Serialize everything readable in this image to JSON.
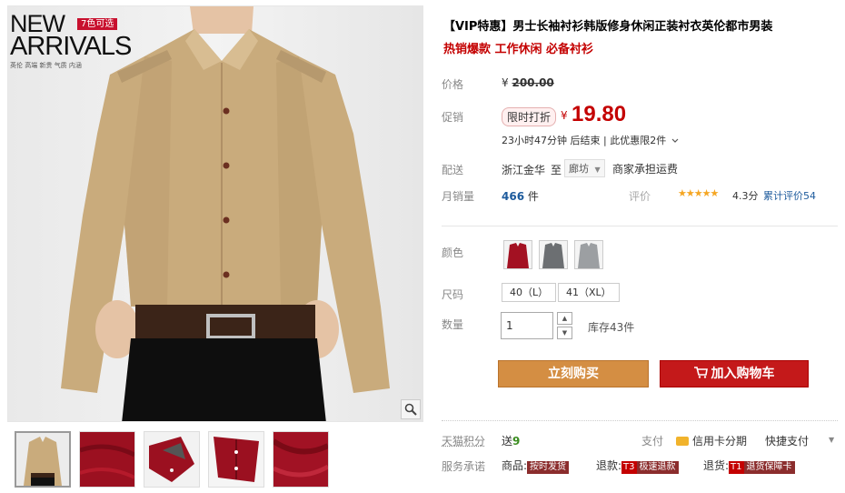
{
  "gallery": {
    "logo_line1": "NEW",
    "logo_line2": "ARRIVALS",
    "logo_badge": "7色可选",
    "logo_tags": "英伦  高端  新贵   气质   内涵",
    "zoom_icon": "magnifier-icon",
    "thumbnails": [
      "thumb-khaki-shirt",
      "thumb-red-shirt",
      "thumb-red-collar",
      "thumb-red-sleeve",
      "thumb-red-fabric"
    ]
  },
  "product": {
    "title": "【VIP特惠】男士长袖衬衫韩版修身休闲正装衬衣英伦都市男装",
    "subtitle": "热销爆款 工作休闲 必备衬衫"
  },
  "pricing": {
    "price_label": "价格",
    "currency": "¥",
    "original_price": "200.00",
    "promo_label": "促销",
    "promo_badge": "限时打折",
    "current_price": "19.80",
    "timer_text": "23小时47分钟 后结束 | 此优惠限2件",
    "timer_chevron": "chevron-down-icon"
  },
  "shipping": {
    "label": "配送",
    "from": "浙江金华",
    "to_word": "至",
    "destination": "廊坊",
    "fee_text": "商家承担运费"
  },
  "sales": {
    "label": "月销量",
    "count": "466",
    "unit": "件",
    "rating_label": "评价",
    "stars": "★★★★★",
    "score": "4.3分",
    "review_text": "累计评价",
    "review_count": "54"
  },
  "options": {
    "color_label": "颜色",
    "colors": [
      "red",
      "gray",
      "light-gray"
    ],
    "size_label": "尺码",
    "sizes": [
      "40（L）",
      "41（XL）"
    ],
    "qty_label": "数量",
    "qty_value": "1",
    "stock_text": "库存43件"
  },
  "actions": {
    "buy_now": "立刻购买",
    "add_to_cart": "加入购物车",
    "cart_icon": "cart-icon"
  },
  "services": {
    "points_label": "天猫积分",
    "points_prefix": "送",
    "points_value": "9",
    "pay_label": "支付",
    "credit_text": "信用卡分期",
    "quick_pay": "快捷支付",
    "promise_label": "服务承诺",
    "goods_label": "商品:",
    "goods_tag": "按时发货",
    "refund_label": "退款:",
    "refund_num": "T3",
    "refund_tag": "极速退款",
    "return_label": "退货:",
    "return_num": "T1",
    "return_tag": "退货保障卡"
  },
  "colors": {
    "price_red": "#c40000",
    "buy_orange": "#d48e43",
    "cart_red": "#c4191a",
    "shirt_khaki": "#c9ab7c",
    "link_blue": "#1c5a9c"
  }
}
